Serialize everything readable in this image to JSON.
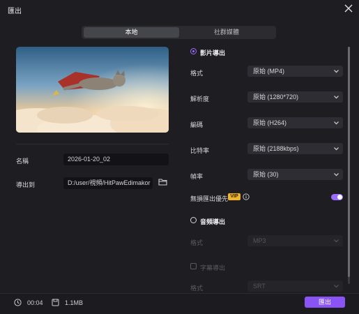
{
  "window": {
    "title": "匯出"
  },
  "tabs": [
    {
      "label": "本地",
      "active": true
    },
    {
      "label": "社群媒體",
      "active": false
    }
  ],
  "left": {
    "name_label": "名稱",
    "name_value": "2026-01-20_02",
    "export_to_label": "導出到",
    "export_path": "D:/user/視頻/HitPawEdimakor"
  },
  "video": {
    "section_label": "影片導出",
    "format_label": "格式",
    "format_value": "原始 (MP4)",
    "resolution_label": "解析度",
    "resolution_value": "原始 (1280*720)",
    "codec_label": "編碼",
    "codec_value": "原始 (H264)",
    "bitrate_label": "比特率",
    "bitrate_value": "原始 (2188kbps)",
    "framerate_label": "幀率",
    "framerate_value": "原始 (30)",
    "lossless_label": "無損匯出優先",
    "vip_badge": "VIP",
    "lossless_on": true
  },
  "audio": {
    "section_label": "音頻導出",
    "format_label": "格式",
    "format_value": "MP3"
  },
  "subtitle": {
    "checkbox_label": "字幕導出",
    "format_label": "格式",
    "format_value": "SRT"
  },
  "footer": {
    "duration": "00:04",
    "filesize": "1.1MB",
    "export_label": "匯出"
  },
  "colors": {
    "accent": "#8a54f5",
    "vip": "#f0b429",
    "background": "#1e1e22"
  }
}
